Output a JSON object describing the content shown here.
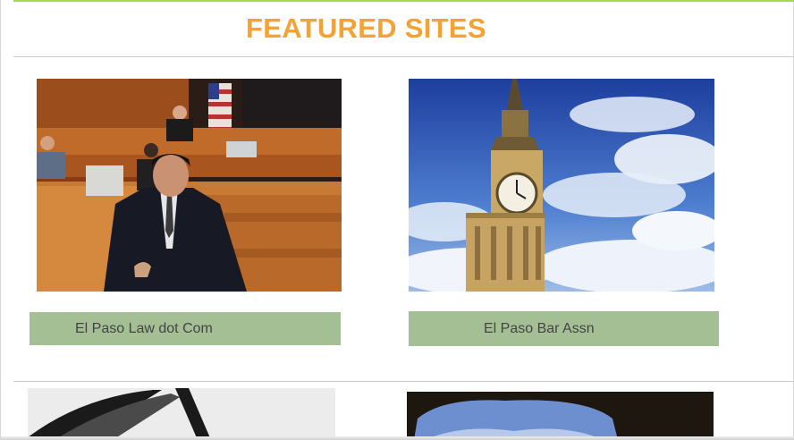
{
  "header": {
    "title": "FEATURED SITES"
  },
  "featured": [
    {
      "label": "El Paso Law dot Com",
      "image": "courtroom-photo"
    },
    {
      "label": "El Paso Bar Assn",
      "image": "big-ben-clock-tower-photo"
    }
  ],
  "colors": {
    "accent_title": "#f3a233",
    "label_bg": "#a4bf93",
    "top_rule": "#a6d84a"
  }
}
